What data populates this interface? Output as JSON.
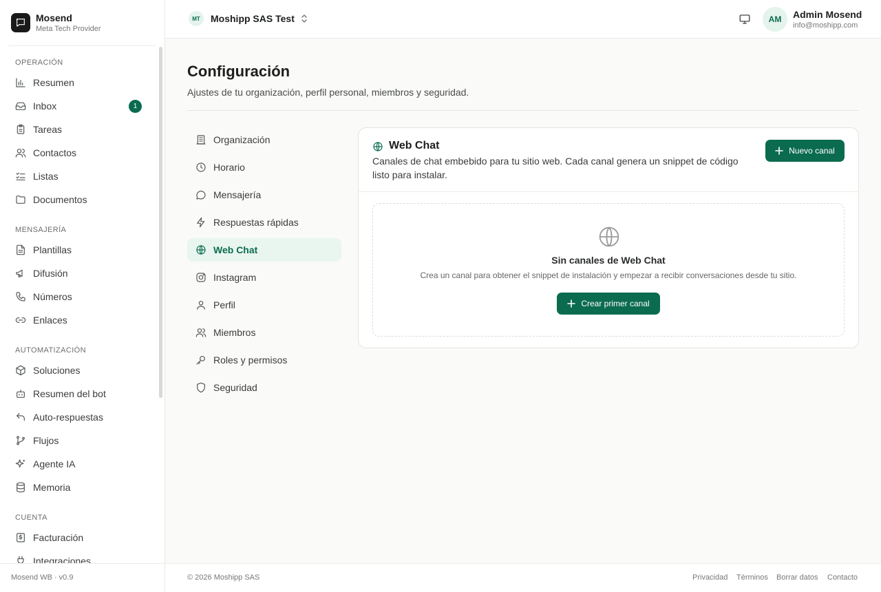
{
  "brand": {
    "name": "Mosend",
    "subtitle": "Meta Tech Provider",
    "logo_icon": "chat-square-icon"
  },
  "sidebar": {
    "sections": [
      {
        "title": "OPERACIÓN",
        "items": [
          {
            "label": "Resumen",
            "icon": "bar-chart-icon"
          },
          {
            "label": "Inbox",
            "icon": "inbox-icon",
            "badge": "1"
          },
          {
            "label": "Tareas",
            "icon": "clipboard-icon"
          },
          {
            "label": "Contactos",
            "icon": "users-icon"
          },
          {
            "label": "Listas",
            "icon": "list-check-icon"
          },
          {
            "label": "Documentos",
            "icon": "folder-icon"
          }
        ]
      },
      {
        "title": "MENSAJERÍA",
        "items": [
          {
            "label": "Plantillas",
            "icon": "file-text-icon"
          },
          {
            "label": "Difusión",
            "icon": "megaphone-icon"
          },
          {
            "label": "Números",
            "icon": "phone-icon"
          },
          {
            "label": "Enlaces",
            "icon": "link-icon"
          }
        ]
      },
      {
        "title": "AUTOMATIZACIÓN",
        "items": [
          {
            "label": "Soluciones",
            "icon": "package-icon"
          },
          {
            "label": "Resumen del bot",
            "icon": "bot-icon"
          },
          {
            "label": "Auto-respuestas",
            "icon": "reply-icon"
          },
          {
            "label": "Flujos",
            "icon": "git-branch-icon"
          },
          {
            "label": "Agente IA",
            "icon": "sparkles-icon"
          },
          {
            "label": "Memoria",
            "icon": "database-icon"
          }
        ]
      },
      {
        "title": "CUENTA",
        "items": [
          {
            "label": "Facturación",
            "icon": "receipt-icon"
          },
          {
            "label": "Integraciones",
            "icon": "plug-icon"
          }
        ]
      }
    ],
    "version": "Mosend WB · v0.9"
  },
  "topbar": {
    "org_initials": "MT",
    "org_name": "Moshipp SAS Test",
    "user_initials": "AM",
    "user_name": "Admin Mosend",
    "user_email": "info@moshipp.com"
  },
  "page": {
    "title": "Configuración",
    "subtitle": "Ajustes de tu organización, perfil personal, miembros y seguridad."
  },
  "settings_nav": [
    {
      "label": "Organización",
      "icon": "building-icon"
    },
    {
      "label": "Horario",
      "icon": "clock-icon"
    },
    {
      "label": "Mensajería",
      "icon": "message-circle-icon"
    },
    {
      "label": "Respuestas rápidas",
      "icon": "zap-icon"
    },
    {
      "label": "Web Chat",
      "icon": "globe-icon",
      "active": true
    },
    {
      "label": "Instagram",
      "icon": "instagram-icon"
    },
    {
      "label": "Perfil",
      "icon": "user-icon"
    },
    {
      "label": "Miembros",
      "icon": "users-icon"
    },
    {
      "label": "Roles y permisos",
      "icon": "key-icon"
    },
    {
      "label": "Seguridad",
      "icon": "shield-icon"
    }
  ],
  "webchat": {
    "title": "Web Chat",
    "description": "Canales de chat embebido para tu sitio web. Cada canal genera un snippet de código listo para instalar.",
    "new_button": "Nuevo canal",
    "empty_title": "Sin canales de Web Chat",
    "empty_description": "Crea un canal para obtener el snippet de instalación y empezar a recibir conversaciones desde tu sitio.",
    "empty_button": "Crear primer canal"
  },
  "footer": {
    "copyright": "© 2026 Moshipp SAS",
    "links": [
      "Privacidad",
      "Términos",
      "Borrar datos",
      "Contacto"
    ]
  },
  "colors": {
    "accent": "#0b6b4f",
    "accent_light": "#e9f6ef"
  }
}
